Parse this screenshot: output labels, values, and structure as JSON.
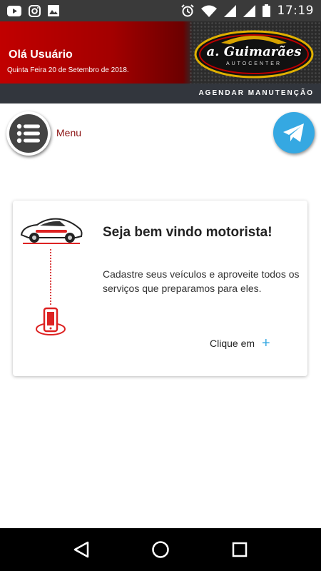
{
  "status": {
    "time": "17:19",
    "left_icons": [
      "youtube-icon",
      "instagram-icon",
      "gallery-icon"
    ],
    "right_icons": [
      "alarm-icon",
      "wifi-icon",
      "signal-icon",
      "signal-icon",
      "battery-icon"
    ]
  },
  "header": {
    "greeting": "Olá Usuário",
    "date": "Quinta Feira 20 de Setembro de 2018.",
    "logo_title": "a. Guimarães",
    "logo_subtitle": "AUTOCENTER",
    "agenda_label": "AGENDAR MANUTENÇÃO"
  },
  "menu": {
    "label": "Menu",
    "icon": "list-icon"
  },
  "telegram": {
    "icon": "telegram-icon"
  },
  "card": {
    "title": "Seja bem vindo motorista!",
    "description": "Cadastre seus veículos e aproveite todos os serviços que preparamos para eles.",
    "action_label": "Clique em",
    "action_icon": "plus-icon"
  },
  "colors": {
    "header_red": "#c10000",
    "dark_bar": "#32363d",
    "menu_label": "#8b1212",
    "accent_blue": "#35a8e2"
  }
}
